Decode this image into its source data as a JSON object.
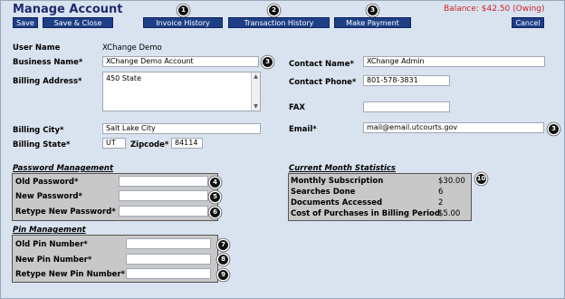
{
  "header": {
    "title": "Manage Account",
    "balance": "Balance:  $42.50 (Owing)"
  },
  "toolbar": {
    "save": "Save",
    "save_close": "Save & Close",
    "invoice_history": "Invoice History",
    "transaction_history": "Transaction History",
    "make_payment": "Make Payment",
    "cancel": "Cancel"
  },
  "callouts": [
    "1",
    "2",
    "3",
    "3",
    "3",
    "4",
    "5",
    "6",
    "7",
    "8",
    "9",
    "10"
  ],
  "account": {
    "user_name_label": "User Name",
    "user_name_value": "XChange Demo",
    "business_name_label": "Business Name*",
    "business_name_value": "XChange Demo Account",
    "billing_address_label": "Billing Address*",
    "billing_address_value": "450 State",
    "billing_city_label": "Billing City*",
    "billing_city_value": "Salt Lake City",
    "billing_state_label": "Billing State*",
    "billing_state_value": "UT",
    "zipcode_label": "Zipcode*",
    "zipcode_value": "84114",
    "contact_name_label": "Contact Name*",
    "contact_name_value": "XChange Admin",
    "contact_phone_label": "Contact Phone*",
    "contact_phone_value": "801-578-3831",
    "fax_label": "FAX",
    "fax_value": "",
    "email_label": "Email*",
    "email_value": "mail@email.utcourts.gov"
  },
  "password": {
    "section_title": "Password Management",
    "old_label": "Old Password*",
    "new_label": "New Password*",
    "retype_label": "Retype New Password*"
  },
  "pin": {
    "section_title": "Pin Management",
    "old_label": "Old Pin Number*",
    "new_label": "New Pin Number*",
    "retype_label": "Retype New Pin Number*"
  },
  "stats": {
    "section_title": "Current Month Statistics",
    "rows": [
      {
        "label": "Monthly Subscription",
        "value": "$30.00"
      },
      {
        "label": "Searches Done",
        "value": "6"
      },
      {
        "label": "Documents Accessed",
        "value": "2"
      },
      {
        "label": "Cost of Purchases in Billing Period",
        "value": "$5.00"
      }
    ]
  }
}
